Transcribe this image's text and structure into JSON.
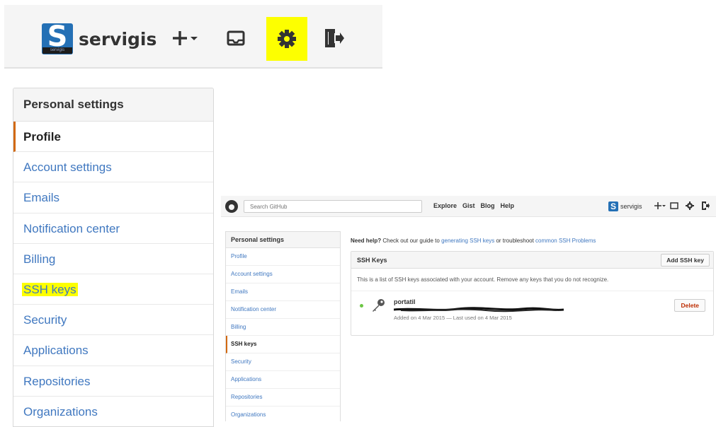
{
  "zoom_header": {
    "username": "servigis",
    "avatar_letter": "S",
    "avatar_caption": "servigis",
    "icons": [
      "plus-dropdown-icon",
      "inbox-icon",
      "gear-icon",
      "sign-out-icon"
    ],
    "highlight_color": "#fdff00"
  },
  "zoom_sidebar": {
    "heading": "Personal settings",
    "items": [
      {
        "label": "Profile"
      },
      {
        "label": "Account settings"
      },
      {
        "label": "Emails"
      },
      {
        "label": "Notification center"
      },
      {
        "label": "Billing"
      },
      {
        "label": "SSH keys"
      },
      {
        "label": "Security"
      },
      {
        "label": "Applications"
      },
      {
        "label": "Repositories"
      },
      {
        "label": "Organizations"
      }
    ]
  },
  "gh": {
    "search_placeholder": "Search GitHub",
    "nav": [
      "Explore",
      "Gist",
      "Blog",
      "Help"
    ],
    "username": "servigis",
    "sidebar": {
      "heading": "Personal settings",
      "items": [
        {
          "label": "Profile"
        },
        {
          "label": "Account settings"
        },
        {
          "label": "Emails"
        },
        {
          "label": "Notification center"
        },
        {
          "label": "Billing"
        },
        {
          "label": "SSH keys"
        },
        {
          "label": "Security"
        },
        {
          "label": "Applications"
        },
        {
          "label": "Repositories"
        },
        {
          "label": "Organizations"
        }
      ]
    },
    "help": {
      "lead": "Need help?",
      "text1": " Check out our guide to ",
      "link1": "generating SSH keys",
      "text2": " or troubleshoot ",
      "link2": "common SSH Problems"
    },
    "panel": {
      "title": "SSH Keys",
      "add_button": "Add SSH key",
      "description": "This is a list of SSH keys associated with your account. Remove any keys that you do not recognize.",
      "key": {
        "name": "portatil",
        "meta": "Added on 4 Mar 2015 — Last used on 4 Mar 2015",
        "delete_button": "Delete",
        "status_color": "#6cc644"
      }
    },
    "accent_color": "#d26911",
    "link_color": "#4078c0"
  }
}
